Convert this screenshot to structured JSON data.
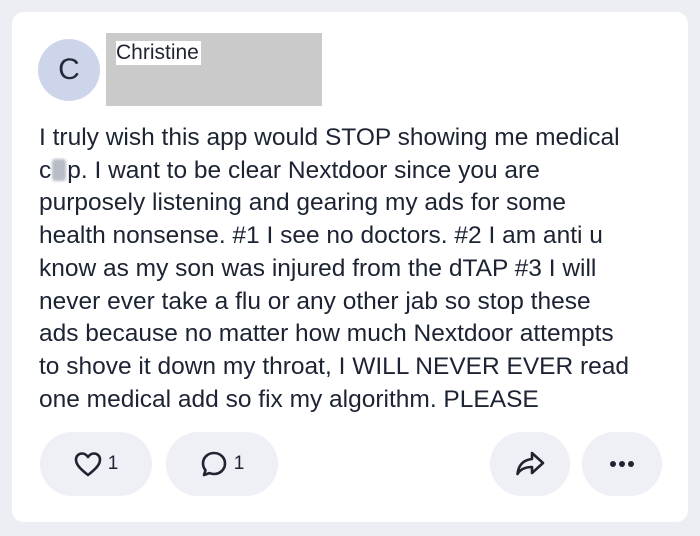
{
  "post": {
    "avatar_initial": "C",
    "author_name": "Christine",
    "text_lines": [
      "I truly wish this app would STOP showing me medical",
      ".  I want to be clear Nextdoor since you are",
      "purposely listening and gearing my ads for some",
      "health nonsense. #1 I see no doctors. #2 I am anti u",
      "know as my son was injured from the dTAP #3 I will",
      "never ever take a flu or any other jab so stop these",
      "ads because no matter how much Nextdoor attempts",
      "to shove it down my throat, I WILL NEVER EVER read",
      "one medical add so fix my algorithm. PLEASE"
    ],
    "line2_prefix": "c",
    "line2_suffix": "p",
    "like_count": "1",
    "comment_count": "1"
  },
  "icons": {
    "like": "heart-icon",
    "comment": "comment-icon",
    "share": "share-icon",
    "more": "more-dots-icon"
  }
}
